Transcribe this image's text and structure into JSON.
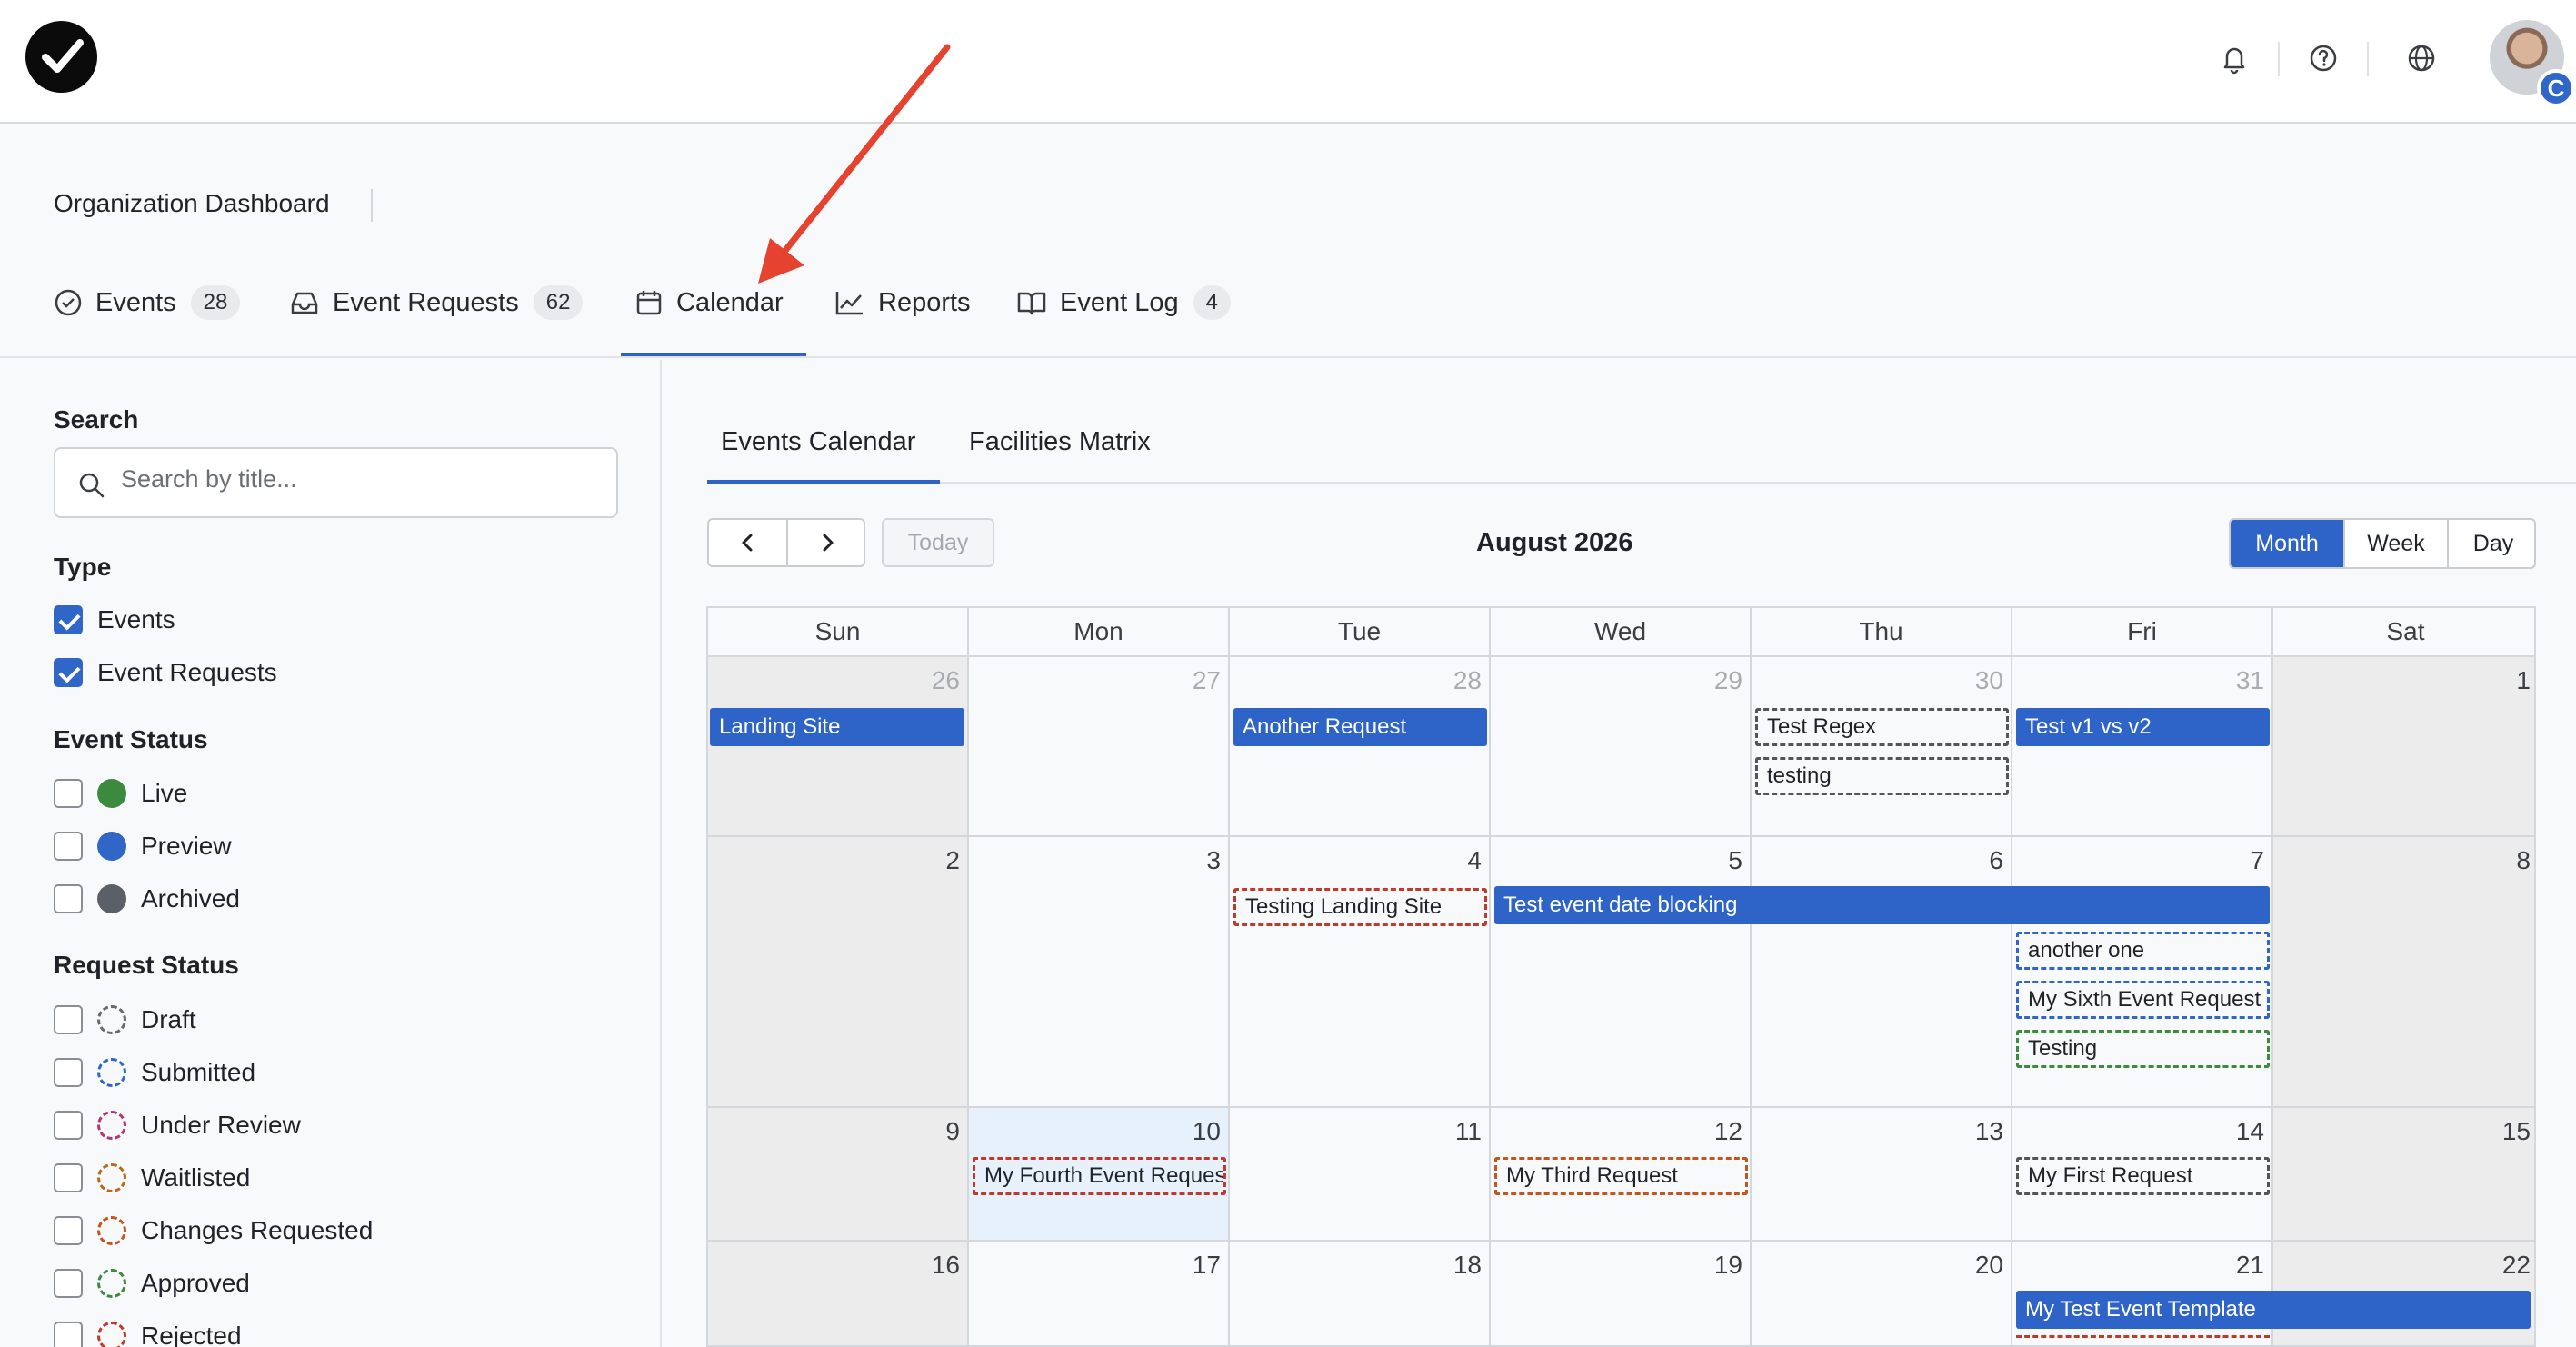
{
  "header": {
    "org_title": "Organization Dashboard",
    "tabs": [
      {
        "label": "Events",
        "badge": "28",
        "icon": "check-circle-icon"
      },
      {
        "label": "Event Requests",
        "badge": "62",
        "icon": "inbox-icon"
      },
      {
        "label": "Calendar",
        "badge": "",
        "icon": "calendar-icon",
        "active": true
      },
      {
        "label": "Reports",
        "badge": "",
        "icon": "line-chart-icon"
      },
      {
        "label": "Event Log",
        "badge": "4",
        "icon": "book-icon"
      }
    ]
  },
  "topbar": {
    "icons": [
      "bell-icon",
      "help-icon",
      "globe-icon"
    ],
    "avatar_badge": "C"
  },
  "sidebar": {
    "search_heading": "Search",
    "search_placeholder": "Search by title...",
    "type_heading": "Type",
    "types": [
      {
        "label": "Events",
        "checked": true
      },
      {
        "label": "Event Requests",
        "checked": true
      }
    ],
    "event_status_heading": "Event Status",
    "event_statuses": [
      {
        "label": "Live",
        "color": "#3b8a3e"
      },
      {
        "label": "Preview",
        "color": "#2f66c8"
      },
      {
        "label": "Archived",
        "color": "#5b6068"
      }
    ],
    "request_status_heading": "Request Status",
    "request_statuses": [
      {
        "label": "Draft",
        "color": "#666a70"
      },
      {
        "label": "Submitted",
        "color": "#2f66c8"
      },
      {
        "label": "Under Review",
        "color": "#b8327c"
      },
      {
        "label": "Waitlisted",
        "color": "#b86a1a"
      },
      {
        "label": "Changes Requested",
        "color": "#c2561e"
      },
      {
        "label": "Approved",
        "color": "#3b8a3e"
      },
      {
        "label": "Rejected",
        "color": "#c0392b"
      }
    ]
  },
  "main": {
    "subtabs": [
      "Events Calendar",
      "Facilities Matrix"
    ],
    "today_label": "Today",
    "month_title": "August 2026",
    "views": [
      "Month",
      "Week",
      "Day"
    ],
    "active_view": "Month",
    "weekdays": [
      "Sun",
      "Mon",
      "Tue",
      "Wed",
      "Thu",
      "Fri",
      "Sat"
    ],
    "weeks": [
      [
        "26",
        "27",
        "28",
        "29",
        "30",
        "31",
        "1"
      ],
      [
        "2",
        "3",
        "4",
        "5",
        "6",
        "7",
        "8"
      ],
      [
        "9",
        "10",
        "11",
        "12",
        "13",
        "14",
        "15"
      ],
      [
        "16",
        "17",
        "18",
        "19",
        "20",
        "21",
        "22"
      ]
    ],
    "events": [
      {
        "title": "Landing Site",
        "style": "solid"
      },
      {
        "title": "Another Request",
        "style": "solid"
      },
      {
        "title": "Test Regex",
        "style": "dashed",
        "color": "#555"
      },
      {
        "title": "testing",
        "style": "dashed",
        "color": "#555"
      },
      {
        "title": "Test v1 vs v2",
        "style": "solid"
      },
      {
        "title": "Testing Landing Site",
        "style": "dashed",
        "color": "#c0392b"
      },
      {
        "title": "Test event date blocking",
        "style": "solid"
      },
      {
        "title": "another one",
        "style": "dashed",
        "color": "#2f66c8"
      },
      {
        "title": "My Sixth Event Request",
        "style": "dashed",
        "color": "#2f66c8"
      },
      {
        "title": "Testing",
        "style": "dashed",
        "color": "#3b8a3e"
      },
      {
        "title": "My Fourth Event Request",
        "style": "dashed",
        "color": "#c0392b"
      },
      {
        "title": "My Third Request",
        "style": "dashed",
        "color": "#c2561e"
      },
      {
        "title": "My First Request",
        "style": "dashed",
        "color": "#555"
      },
      {
        "title": "My Test Event Template",
        "style": "solid"
      }
    ]
  },
  "colors": {
    "accent": "#2e64c7",
    "annotation_arrow": "#e5432f"
  }
}
